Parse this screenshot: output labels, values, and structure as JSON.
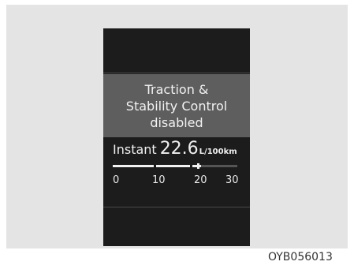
{
  "popup": {
    "line1": "Traction &",
    "line2": "Stability Control",
    "line3": "disabled"
  },
  "fuel": {
    "label": "Instant",
    "value": "22.6",
    "unit": "L/100km",
    "scale_ticks": [
      "0",
      "10",
      "20",
      "30"
    ],
    "level_value": 22.6,
    "scale_max": 30
  },
  "figure_code": "OYB056013"
}
